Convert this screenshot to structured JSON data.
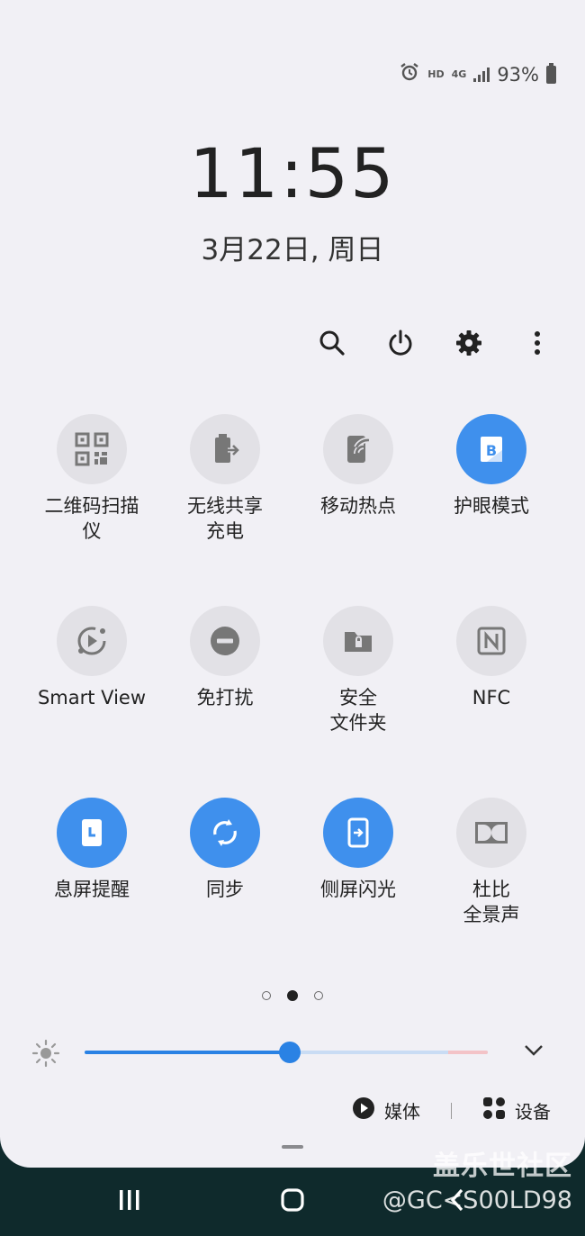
{
  "status": {
    "hd": "HD",
    "network": "4G",
    "battery": "93%"
  },
  "clock": {
    "time": "11:55",
    "date": "3月22日, 周日"
  },
  "toolbar": {
    "icons": [
      "search-icon",
      "power-icon",
      "settings-icon",
      "more-vert-icon"
    ]
  },
  "tiles": [
    {
      "label": "二维码扫描\n仪",
      "icon": "qr-code-icon",
      "active": false
    },
    {
      "label": "无线共享\n充电",
      "icon": "wireless-powershare-icon",
      "active": false
    },
    {
      "label": "移动热点",
      "icon": "hotspot-icon",
      "active": false
    },
    {
      "label": "护眼模式",
      "icon": "blue-light-filter-icon",
      "active": true
    },
    {
      "label": "Smart View",
      "icon": "smart-view-icon",
      "active": false
    },
    {
      "label": "免打扰",
      "icon": "do-not-disturb-icon",
      "active": false
    },
    {
      "label": "安全\n文件夹",
      "icon": "secure-folder-icon",
      "active": false
    },
    {
      "label": "NFC",
      "icon": "nfc-icon",
      "active": false
    },
    {
      "label": "息屏提醒",
      "icon": "always-on-display-icon",
      "active": true
    },
    {
      "label": "同步",
      "icon": "sync-icon",
      "active": true
    },
    {
      "label": "侧屏闪光",
      "icon": "edge-lighting-icon",
      "active": true
    },
    {
      "label": "杜比\n全景声",
      "icon": "dolby-atmos-icon",
      "active": false
    }
  ],
  "pager": {
    "pages": 3,
    "current": 1
  },
  "brightness": {
    "level": 0.51
  },
  "media": {
    "media_label": "媒体",
    "devices_label": "设备"
  },
  "watermark": {
    "line1": "盖乐世社区",
    "line2": "@GC<S00LD98"
  },
  "colors": {
    "accent": "#3f90ed",
    "panel": "#f1f0f5",
    "tile_off": "#e2e1e6"
  }
}
